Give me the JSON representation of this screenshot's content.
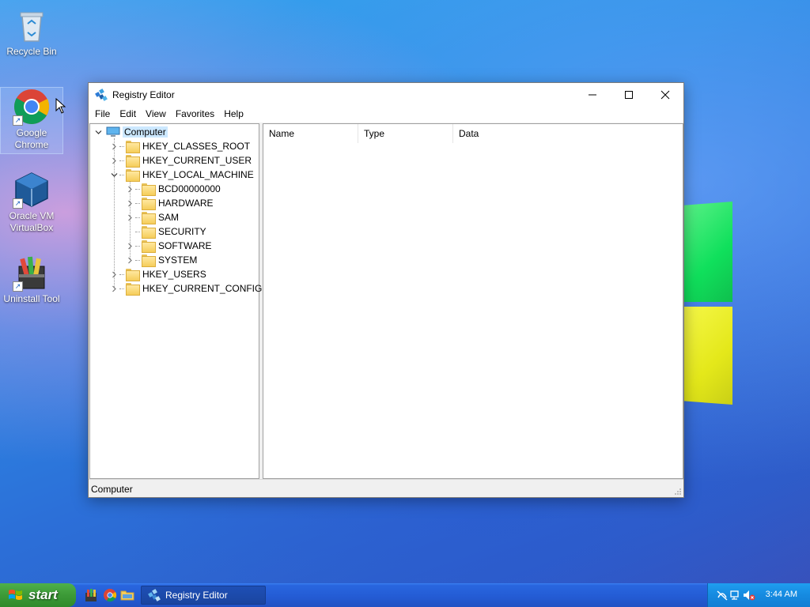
{
  "desktop": {
    "icons": [
      {
        "label": "Recycle Bin"
      },
      {
        "label": "Google Chrome"
      },
      {
        "label": "Oracle VM VirtualBox"
      },
      {
        "label": "Uninstall Tool"
      }
    ]
  },
  "window": {
    "title": "Registry Editor",
    "menu": [
      "File",
      "Edit",
      "View",
      "Favorites",
      "Help"
    ],
    "tree": {
      "root": "Computer",
      "hives": [
        "HKEY_CLASSES_ROOT",
        "HKEY_CURRENT_USER",
        "HKEY_LOCAL_MACHINE",
        "HKEY_USERS",
        "HKEY_CURRENT_CONFIG"
      ],
      "local_machine_children": [
        "BCD00000000",
        "HARDWARE",
        "SAM",
        "SECURITY",
        "SOFTWARE",
        "SYSTEM"
      ]
    },
    "columns": {
      "name": "Name",
      "type": "Type",
      "data": "Data"
    },
    "status": "Computer"
  },
  "taskbar": {
    "start_label": "start",
    "task": "Registry Editor",
    "clock": "3:44 AM"
  }
}
